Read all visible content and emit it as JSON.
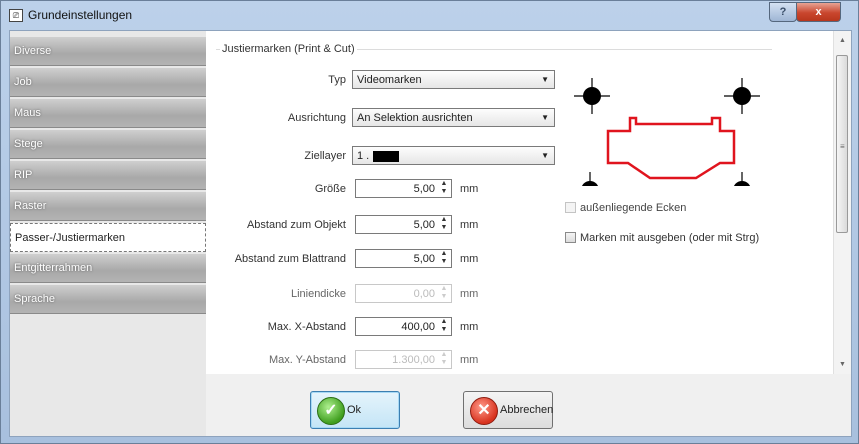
{
  "window": {
    "title": "Grundeinstellungen",
    "help_label": "?",
    "close_label": "x"
  },
  "sidebar": {
    "items": [
      {
        "label": "Diverse"
      },
      {
        "label": "Job"
      },
      {
        "label": "Maus"
      },
      {
        "label": "Stege"
      },
      {
        "label": "RIP"
      },
      {
        "label": "Raster"
      },
      {
        "label": "Passer-/Justiermarken",
        "active": true
      },
      {
        "label": "Entgitterrahmen"
      },
      {
        "label": "Sprache"
      }
    ]
  },
  "group": {
    "title": "Justiermarken (Print & Cut)"
  },
  "fields": {
    "typ": {
      "label": "Typ",
      "value": "Videomarken"
    },
    "ausrichtung": {
      "label": "Ausrichtung",
      "value": "An Selektion ausrichten"
    },
    "ziellayer": {
      "label": "Ziellayer",
      "value": "1 ."
    },
    "groesse": {
      "label": "Größe",
      "value": "5,00",
      "unit": "mm"
    },
    "abstand_objekt": {
      "label": "Abstand zum Objekt",
      "value": "5,00",
      "unit": "mm"
    },
    "abstand_blattrand": {
      "label": "Abstand zum Blattrand",
      "value": "5,00",
      "unit": "mm"
    },
    "liniendicke": {
      "label": "Liniendicke",
      "value": "0,00",
      "unit": "mm",
      "disabled": true
    },
    "max_x": {
      "label": "Max. X-Abstand",
      "value": "400,00",
      "unit": "mm"
    },
    "max_y": {
      "label": "Max. Y-Abstand",
      "value": "1.300,00",
      "unit": "mm",
      "disabled": true
    }
  },
  "checkboxes": {
    "aussen_ecken": {
      "label": "außenliegende Ecken",
      "checked": false,
      "disabled": true
    },
    "marken_ausgeben": {
      "label": "Marken mit ausgeben (oder mit Strg)",
      "checked": false
    }
  },
  "buttons": {
    "ok": "Ok",
    "cancel": "Abbrechen"
  },
  "colors": {
    "shape_outline": "#e0141e",
    "mark": "#000000"
  },
  "icons": [
    "app-icon",
    "help-icon",
    "close-icon",
    "ok-check-icon",
    "cancel-x-icon",
    "registration-mark-icon"
  ]
}
